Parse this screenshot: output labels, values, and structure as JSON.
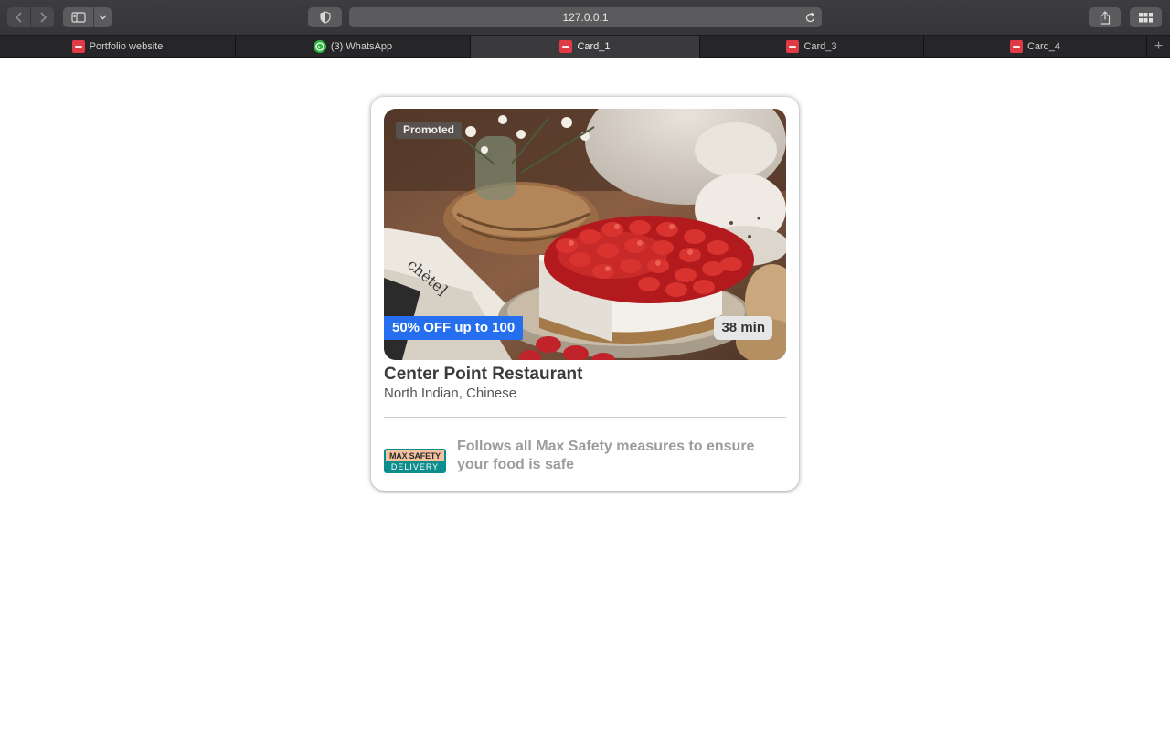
{
  "browser": {
    "url": "127.0.0.1",
    "tabs": [
      {
        "label": "Portfolio website",
        "icon": "zomato-favicon",
        "active": false
      },
      {
        "label": "(3) WhatsApp",
        "icon": "whatsapp-favicon",
        "active": false
      },
      {
        "label": "Card_1",
        "icon": "zomato-favicon",
        "active": true
      },
      {
        "label": "Card_3",
        "icon": "zomato-favicon",
        "active": false
      },
      {
        "label": "Card_4",
        "icon": "zomato-favicon",
        "active": false
      }
    ],
    "new_tab_label": "+"
  },
  "card": {
    "badge": "Promoted",
    "offer": "50% OFF up to 100",
    "delivery_time": "38 min",
    "restaurant_name": "Center Point Restaurant",
    "cuisines": "North Indian, Chinese",
    "safety_logo": {
      "top": "MAX SAFETY",
      "bottom": "DELIVERY"
    },
    "safety_text": "Follows all Max Safety measures to ensure your food is safe",
    "image": "strawberry-cheesecake-photo"
  },
  "colors": {
    "offer_bg": "#256fef",
    "safety_teal": "#0d8d8b",
    "chrome_bg": "#3d3c3e"
  }
}
